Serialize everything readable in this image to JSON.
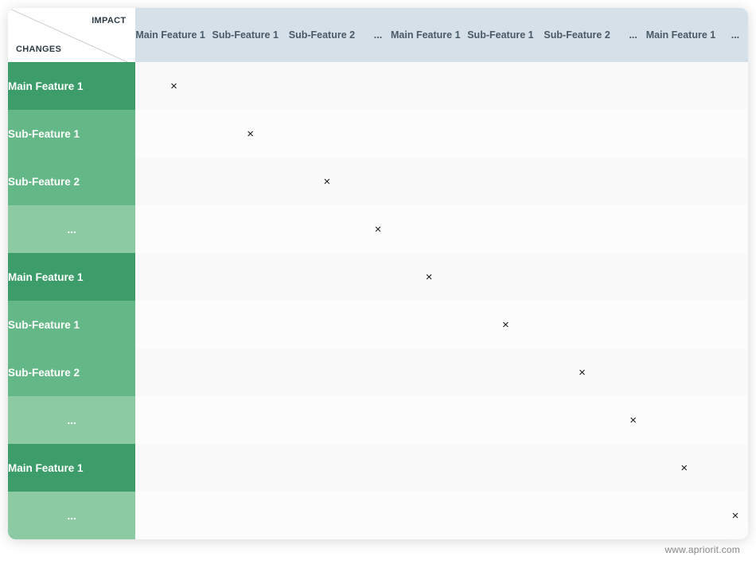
{
  "corner": {
    "impact": "IMPACT",
    "changes": "CHANGES"
  },
  "mark": "×",
  "attribution": "www.apriorit.com",
  "columns": [
    {
      "label": "Main Feature 1",
      "cls": "wide"
    },
    {
      "label": "Sub-Feature 1",
      "cls": "wide"
    },
    {
      "label": "Sub-Feature 2",
      "cls": "wide"
    },
    {
      "label": "...",
      "cls": "narrow"
    },
    {
      "label": "Main Feature 1",
      "cls": "wide"
    },
    {
      "label": "Sub-Feature 1",
      "cls": "wide"
    },
    {
      "label": "Sub-Feature 2",
      "cls": "wide"
    },
    {
      "label": "...",
      "cls": "narrow"
    },
    {
      "label": "Main Feature 1",
      "cls": "wide"
    },
    {
      "label": "...",
      "cls": "narrow"
    }
  ],
  "rows": [
    {
      "label": "Main Feature 1",
      "shade": "dark",
      "mark_col": 0
    },
    {
      "label": "Sub-Feature 1",
      "shade": "mid",
      "mark_col": 1
    },
    {
      "label": "Sub-Feature 2",
      "shade": "mid",
      "mark_col": 2
    },
    {
      "label": "...",
      "shade": "light",
      "mark_col": 3
    },
    {
      "label": "Main Feature 1",
      "shade": "dark",
      "mark_col": 4
    },
    {
      "label": "Sub-Feature 1",
      "shade": "mid",
      "mark_col": 5
    },
    {
      "label": "Sub-Feature 2",
      "shade": "mid",
      "mark_col": 6
    },
    {
      "label": "...",
      "shade": "light",
      "mark_col": 7
    },
    {
      "label": "Main Feature 1",
      "shade": "dark",
      "mark_col": 8
    },
    {
      "label": "...",
      "shade": "light",
      "mark_col": 9
    }
  ]
}
